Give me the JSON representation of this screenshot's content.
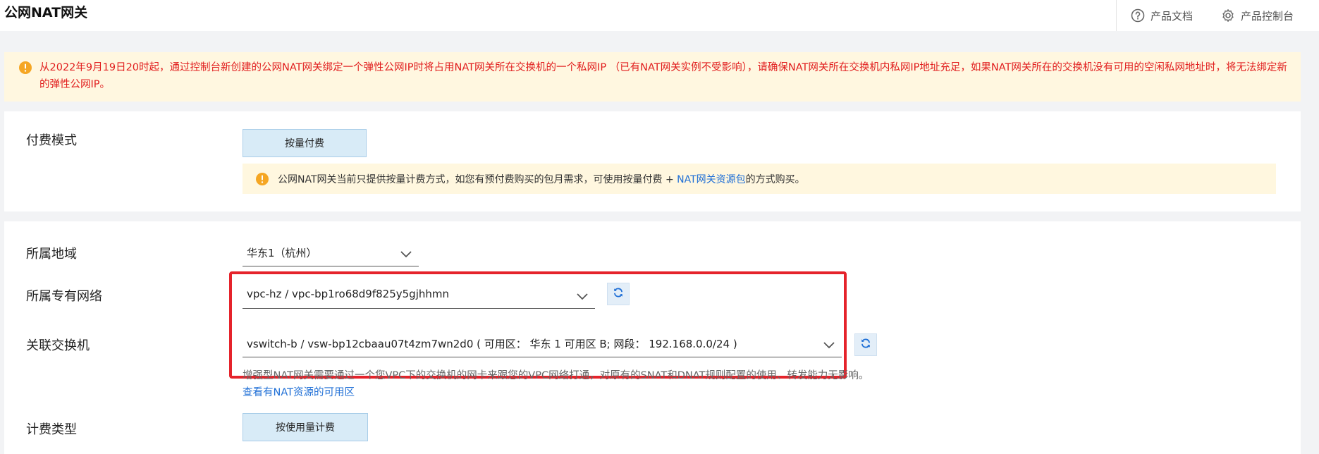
{
  "header": {
    "title": "公网NAT网关",
    "docs_label": "产品文档",
    "console_label": "产品控制台"
  },
  "warning_banner": {
    "text": "从2022年9月19日20时起，通过控制台新创建的公网NAT网关绑定一个弹性公网IP时将占用NAT网关所在交换机的一个私网IP （已有NAT网关实例不受影响），请确保NAT网关所在交换机内私网IP地址充足，如果NAT网关所在的交换机没有可用的空闲私网地址时，将无法绑定新的弹性公网IP。"
  },
  "billing_mode": {
    "label": "付费模式",
    "option": "按量付费",
    "info_prefix": "公网NAT网关当前只提供按量计费方式，如您有预付费购买的包月需求，可使用按量付费 + ",
    "info_link": "NAT网关资源包",
    "info_suffix": "的方式购买。"
  },
  "region": {
    "label": "所属地域",
    "value": "华东1（杭州）"
  },
  "vpc": {
    "label": "所属专有网络",
    "value": "vpc-hz / vpc-bp1ro68d9f825y5gjhhmn"
  },
  "vswitch": {
    "label": "关联交换机",
    "value": "vswitch-b / vsw-bp12cbaau07t4zm7wn2d0 ( 可用区： 华东 1 可用区 B; 网段： 192.168.0.0/24 )",
    "help": "增强型NAT网关需要通过一个您VPC下的交换机的网卡来跟您的VPC网络打通，对原有的SNAT和DNAT规则配置的使用、转发能力无影响。",
    "help_link": "查看有NAT资源的可用区"
  },
  "charge_type": {
    "label": "计费类型",
    "option": "按使用量计费"
  },
  "colors": {
    "highlight": "#e5232b",
    "link": "#1f6fd6",
    "warning_text": "#e11d1d",
    "selected_bg": "#d8ebf7"
  }
}
